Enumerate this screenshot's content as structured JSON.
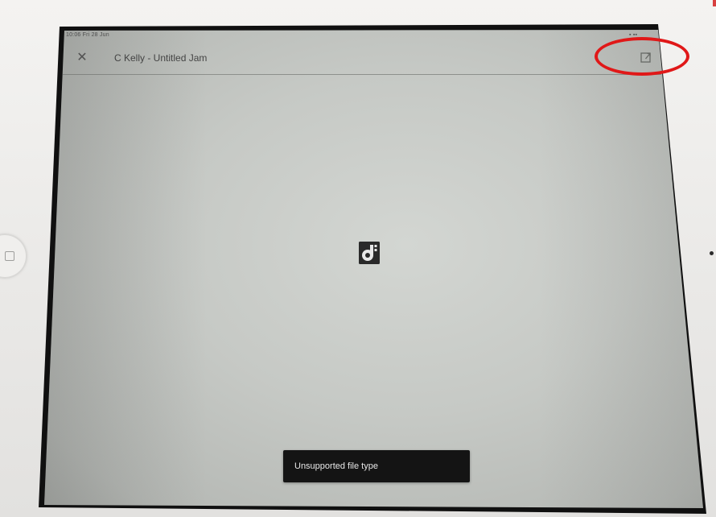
{
  "status_bar": {
    "time_date": "10:06  Fri 28 Jun",
    "right_indicators": "▪ ▪▪"
  },
  "header": {
    "close_icon": "close-icon",
    "close_glyph": "✕",
    "title": "C Kelly - Untitled Jam",
    "share_icon": "share-icon"
  },
  "content": {
    "app_icon": "jamboard-icon"
  },
  "toast": {
    "message": "Unsupported file type"
  },
  "annotation": {
    "color": "#e01818"
  },
  "colors": {
    "screen_bg": "#c6c9c5",
    "toast_bg": "#141414",
    "icon_bg": "#2a2a2a"
  }
}
